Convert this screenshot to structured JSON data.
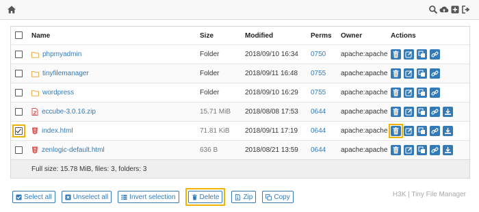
{
  "header": {
    "icons": [
      "home-icon",
      "search-icon",
      "cloud-upload-icon",
      "plus-square-icon",
      "sign-out-icon"
    ]
  },
  "table": {
    "columns": [
      "Name",
      "Size",
      "Modified",
      "Perms",
      "Owner",
      "Actions"
    ],
    "rows": [
      {
        "name": "phpmyadmin",
        "type": "folder",
        "size": "Folder",
        "modified": "2018/09/10 16:34",
        "perms": "0750",
        "owner": "apache:apache",
        "checked": false
      },
      {
        "name": "tinyfilemanager",
        "type": "folder",
        "size": "Folder",
        "modified": "2018/09/11 16:48",
        "perms": "0755",
        "owner": "apache:apache",
        "checked": false
      },
      {
        "name": "wordpress",
        "type": "folder",
        "size": "Folder",
        "modified": "2018/09/10 16:29",
        "perms": "0755",
        "owner": "apache:apache",
        "checked": false
      },
      {
        "name": "eccube-3.0.16.zip",
        "type": "zip",
        "size": "15.71 MiB",
        "modified": "2018/08/08 17:53",
        "perms": "0644",
        "owner": "apache:apache",
        "checked": false
      },
      {
        "name": "index.html",
        "type": "html",
        "size": "71.81 KiB",
        "modified": "2018/09/11 17:19",
        "perms": "0644",
        "owner": "apache:apache",
        "checked": true
      },
      {
        "name": "zenlogic-default.html",
        "type": "html",
        "size": "636 B",
        "modified": "2018/08/21 13:59",
        "perms": "0644",
        "owner": "apache:apache",
        "checked": false
      }
    ],
    "footer": "Full size: 15.78 MiB, files: 3, folders: 3"
  },
  "toolbar": {
    "select_all": "Select all",
    "unselect_all": "Unselect all",
    "invert_selection": "Invert selection",
    "delete": "Delete",
    "zip": "Zip",
    "copy": "Copy"
  },
  "brand": "H3K | Tiny File Manager",
  "colors": {
    "accent": "#337ab7",
    "highlight": "#f0b400",
    "folder": "#f0ad4e",
    "file_red": "#d9534f"
  }
}
